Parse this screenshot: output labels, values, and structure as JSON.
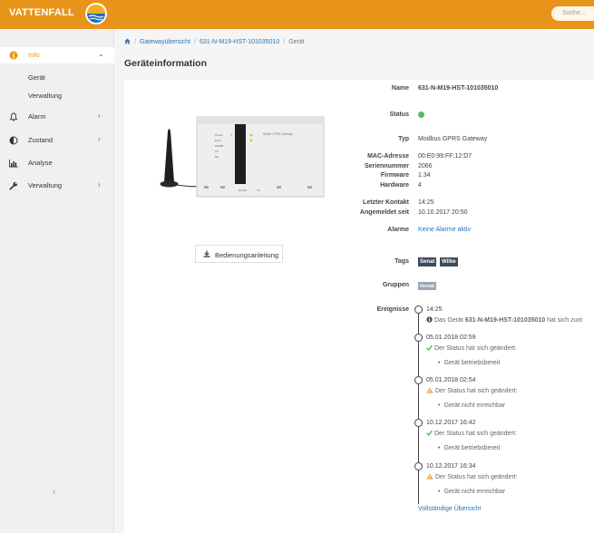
{
  "header": {
    "logo_text": "VATTENFALL",
    "search_placeholder": "Suche..."
  },
  "sidebar": {
    "items": [
      {
        "label": "Info",
        "icon": "info-circle-icon",
        "active": true
      },
      {
        "label": "Alarm",
        "icon": "bell-icon"
      },
      {
        "label": "Zustand",
        "icon": "half-circle-icon"
      },
      {
        "label": "Analyse",
        "icon": "bar-chart-icon"
      },
      {
        "label": "Verwaltung",
        "icon": "wrench-icon"
      }
    ],
    "info_sub": [
      "Gerät",
      "Verwaltung"
    ],
    "collapse_icon": "chevron-left-icon"
  },
  "breadcrumb": [
    "Gatewayübersicht",
    "631-N-M19-HST-101035010",
    "Gerät"
  ],
  "page_title": "Geräteinformation",
  "manual_button": "Bedienungsanleitung",
  "device": {
    "name_label": "Name",
    "name": "631-N-M19-HST-101035010",
    "status_label": "Status",
    "status_color": "#5cb85c",
    "type_label": "Typ",
    "type": "Modbus GPRS Gateway",
    "mac_label": "MAC-Adresse",
    "mac": "00:E0:99:FF:12:D7",
    "serial_label": "Seriennummer",
    "serial": "2066",
    "firmware_label": "Firmware",
    "firmware": "1.34",
    "hardware_label": "Hardware",
    "hardware": "4",
    "last_contact_label": "Letzter Kontakt",
    "last_contact": "14:25",
    "registered_label": "Angemeldet seit",
    "registered": "10.10.2017 20:50",
    "alarms_label": "Alarme",
    "alarms": "Keine Alarme aktiv",
    "tags_label": "Tags",
    "tags": [
      "Senat",
      "Wilke"
    ],
    "groups_label": "Gruppen",
    "groups": [
      "#senat"
    ],
    "events_label": "Ereignisse"
  },
  "events": [
    {
      "time": "14:25",
      "icon": "info-icon",
      "msg_prefix": "Das Gerät ",
      "msg_bold": "631-N-M19-HST-101035010",
      "msg_suffix": " hat sich zum"
    },
    {
      "time": "05.01.2018 02:59",
      "icon": "check-icon",
      "msg": "Der Status hat sich geändert:",
      "detail": "Gerät betriebsbereit"
    },
    {
      "time": "05.01.2018 02:54",
      "icon": "warning-icon",
      "msg": "Der Status hat sich geändert:",
      "detail": "Gerät nicht erreichbar"
    },
    {
      "time": "10.12.2017 16:42",
      "icon": "check-icon",
      "msg": "Der Status hat sich geändert:",
      "detail": "Gerät betriebsbereit"
    },
    {
      "time": "10.12.2017 16:34",
      "icon": "warning-icon",
      "msg": "Der Status hat sich geändert:",
      "detail": "Gerät nicht erreichbar"
    }
  ],
  "full_overview_link": "Vollständige Übersicht",
  "colors": {
    "accent": "#e8941a",
    "link": "#2a74b5",
    "ok": "#5cb85c",
    "warn": "#f0ad4e"
  },
  "device_panel": {
    "brand": "Meiller GPRS-Gateway",
    "leds": [
      "Power",
      "Error",
      "RS485",
      "TX",
      "RX"
    ],
    "ports": [
      "RS485",
      "TB"
    ]
  }
}
